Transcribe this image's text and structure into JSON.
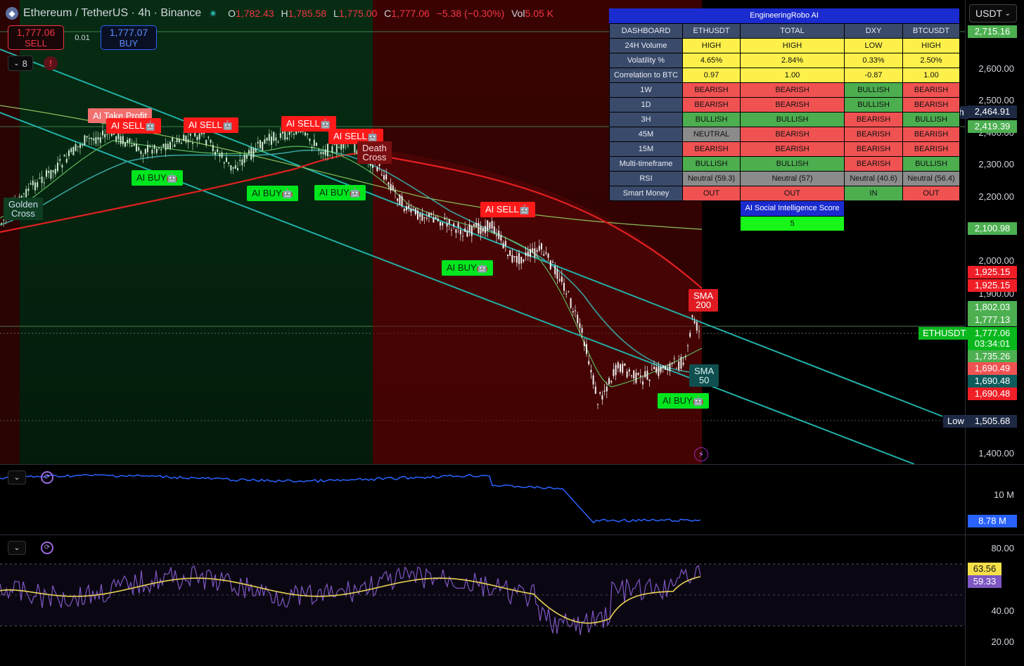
{
  "header": {
    "symbol_title": "Ethereum / TetherUS · 4h · Binance",
    "ohlc": [
      {
        "key": "O",
        "value": "1,782.43"
      },
      {
        "key": "H",
        "value": "1,785.58"
      },
      {
        "key": "L",
        "value": "1,775.00"
      },
      {
        "key": "C",
        "value": "1,777.06"
      }
    ],
    "change": "−5.38 (−0.30%)",
    "vol_key": "Vol",
    "vol_value": "5.05 K",
    "sell_price": "1,777.06",
    "sell_label": "SELL",
    "spread": "0.01",
    "buy_price": "1,777.07",
    "buy_label": "BUY",
    "indicator_count": "8",
    "warning": "!",
    "currency": "USDT"
  },
  "price_axis": {
    "ticks": [
      "2,600.00",
      "2,500.00",
      "2,400.00",
      "2,300.00",
      "2,200.00",
      "2,000.00",
      "1,900.00",
      "1,400.00"
    ],
    "tags": [
      {
        "text": "2,715.16",
        "color": "#4caf50"
      },
      {
        "text": "2,464.91",
        "color": "#1e2a44"
      },
      {
        "text": "2,419.39",
        "color": "#4caf50"
      },
      {
        "text": "2,100.98",
        "color": "#4caf50"
      },
      {
        "text": "1,925.15",
        "color": "#f01e26"
      },
      {
        "text": "1,925.15",
        "color": "#f01e26"
      },
      {
        "text": "1,802.03",
        "color": "#4caf50"
      },
      {
        "text": "1,777.13",
        "color": "#4caf50"
      },
      {
        "text": "1,777.06",
        "color": "#0ab81e"
      },
      {
        "text": "03:34:01",
        "color": "#0ab81e"
      },
      {
        "text": "1,735.26",
        "color": "#4caf50"
      },
      {
        "text": "1,690.49",
        "color": "#f05252"
      },
      {
        "text": "1,690.48",
        "color": "#0f5c5c"
      },
      {
        "text": "1,690.48",
        "color": "#f01e26"
      },
      {
        "text": "1,505.68",
        "color": "#1e2a44"
      }
    ],
    "high_label": "High",
    "low_label": "Low",
    "symbol_tag": "ETHUSDT"
  },
  "signals": {
    "golden_cross": [
      "Golden",
      "Cross"
    ],
    "take_profit": "AI Take Profit",
    "ai_sell": "AI SELL🤖",
    "ai_buy": "AI BUY🤖",
    "death_cross": [
      "Death",
      "Cross"
    ],
    "sma200": [
      "SMA",
      "200"
    ],
    "sma50": [
      "SMA",
      "50"
    ]
  },
  "dashboard": {
    "title": "EngineeringRobo AI",
    "columns": [
      "DASHBOARD",
      "ETHUSDT",
      "TOTAL",
      "DXY",
      "BTCUSDT"
    ],
    "rows": [
      {
        "label": "24H Volume",
        "cells": [
          [
            "HIGH",
            "yellow"
          ],
          [
            "HIGH",
            "yellow"
          ],
          [
            "LOW",
            "yellow"
          ],
          [
            "HIGH",
            "yellow"
          ]
        ]
      },
      {
        "label": "Volatility %",
        "cells": [
          [
            "4.65%",
            "yellow"
          ],
          [
            "2.84%",
            "yellow"
          ],
          [
            "0.33%",
            "yellow"
          ],
          [
            "2.50%",
            "yellow"
          ]
        ]
      },
      {
        "label": "Correlation to BTC",
        "cells": [
          [
            "0.97",
            "yellow"
          ],
          [
            "1.00",
            "yellow"
          ],
          [
            "-0.87",
            "yellow"
          ],
          [
            "1.00",
            "yellow"
          ]
        ]
      },
      {
        "label": "1W",
        "cells": [
          [
            "BEARISH",
            "red"
          ],
          [
            "BEARISH",
            "red"
          ],
          [
            "BULLISH",
            "green"
          ],
          [
            "BEARISH",
            "red"
          ]
        ]
      },
      {
        "label": "1D",
        "cells": [
          [
            "BEARISH",
            "red"
          ],
          [
            "BEARISH",
            "red"
          ],
          [
            "BULLISH",
            "green"
          ],
          [
            "BEARISH",
            "red"
          ]
        ]
      },
      {
        "label": "3H",
        "cells": [
          [
            "BULLISH",
            "green"
          ],
          [
            "BULLISH",
            "green"
          ],
          [
            "BEARISH",
            "red"
          ],
          [
            "BULLISH",
            "green"
          ]
        ]
      },
      {
        "label": "45M",
        "cells": [
          [
            "NEUTRAL",
            "grey"
          ],
          [
            "BEARISH",
            "red"
          ],
          [
            "BEARISH",
            "red"
          ],
          [
            "BEARISH",
            "red"
          ]
        ]
      },
      {
        "label": "15M",
        "cells": [
          [
            "BEARISH",
            "red"
          ],
          [
            "BEARISH",
            "red"
          ],
          [
            "BEARISH",
            "red"
          ],
          [
            "BEARISH",
            "red"
          ]
        ]
      },
      {
        "label": "Multi-timeframe",
        "cells": [
          [
            "BULLISH",
            "green"
          ],
          [
            "BULLISH",
            "green"
          ],
          [
            "BEARISH",
            "red"
          ],
          [
            "BULLISH",
            "green"
          ]
        ]
      },
      {
        "label": "RSI",
        "cells": [
          [
            "Neutral (59.3)",
            "grey"
          ],
          [
            "Neutral (57)",
            "grey"
          ],
          [
            "Neutral (40.6)",
            "grey"
          ],
          [
            "Neutral (56.4)",
            "grey"
          ]
        ]
      },
      {
        "label": "Smart Money",
        "cells": [
          [
            "OUT",
            "red"
          ],
          [
            "OUT",
            "red"
          ],
          [
            "IN",
            "green"
          ],
          [
            "OUT",
            "red"
          ]
        ]
      }
    ],
    "social_title": "AI Social Intelligence Score",
    "social_value": "5"
  },
  "volume_panel": {
    "axis_label": "10 M",
    "value_tag": "8.78 M"
  },
  "rsi_panel": {
    "ticks": [
      "80.00",
      "40.00",
      "20.00"
    ],
    "value_tag_yellow": "63.56",
    "value_tag_purple": "59.33"
  },
  "colors": {
    "up": "#22ab94",
    "down": "#f23645",
    "sell_signal": "#ff1a1a",
    "buy_signal": "#00e61e",
    "channel": "#21b0a8",
    "sma200": "#e02020",
    "volume_line": "#2962ff",
    "rsi_line": "#7e57c2",
    "rsi_ma": "#f5e04a"
  }
}
